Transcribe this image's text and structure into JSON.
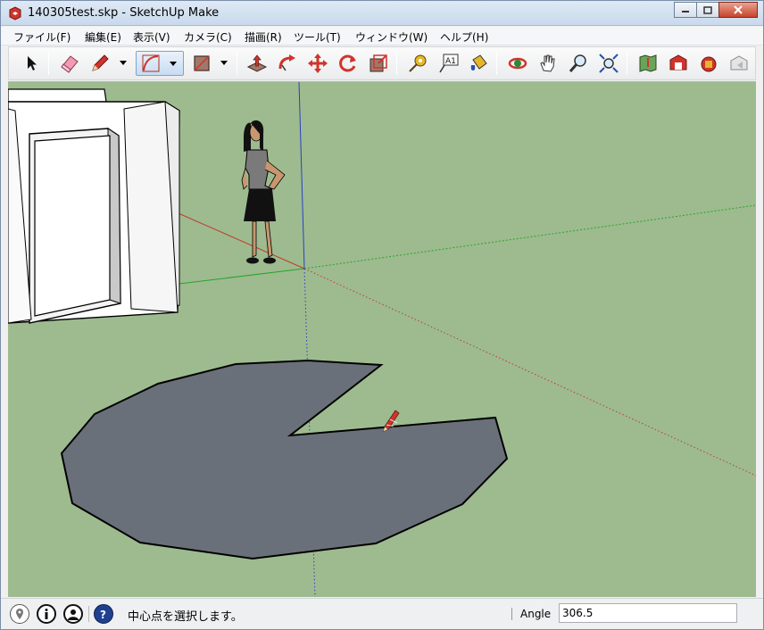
{
  "window": {
    "title": "140305test.skp - SketchUp Make"
  },
  "menu": [
    "ファイル(F)",
    "編集(E)",
    "表示(V)",
    "カメラ(C)",
    "描画(R)",
    "ツール(T)",
    "ウィンドウ(W)",
    "ヘルプ(H)"
  ],
  "toolbar": {
    "tools": [
      "select-tool",
      "eraser-tool",
      "pencil-tool",
      "arc-tool",
      "rectangle-tool",
      "push-pull-tool",
      "follow-me-tool",
      "move-tool",
      "rotate-tool",
      "scale-tool",
      "tape-measure-tool",
      "text-tool",
      "paint-bucket-tool",
      "orbit-tool",
      "pan-tool",
      "zoom-tool",
      "zoom-extents-tool",
      "add-location-tool",
      "3d-warehouse-tool",
      "extension-warehouse-tool",
      "share-model-tool"
    ],
    "text_tool_glyph": "A1"
  },
  "colors": {
    "ground": "#9dbb8f",
    "shape_fill": "#6a707a",
    "axis_red": "#c23b2b",
    "axis_green": "#2aa32a",
    "axis_blue": "#2a3fc2",
    "accent_red": "#d0342c"
  },
  "status": {
    "hint": "中心点を選択します。",
    "vcb_label": "Angle",
    "vcb_value": "306.5"
  }
}
